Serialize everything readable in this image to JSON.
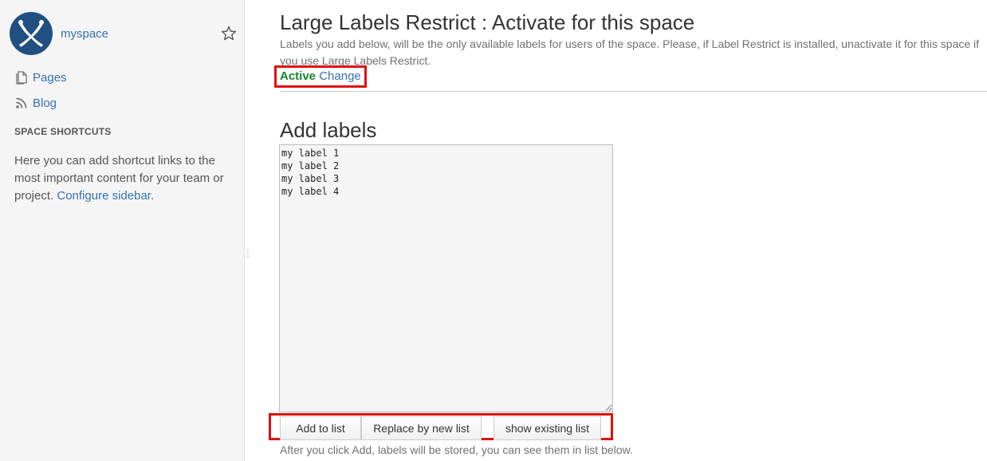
{
  "sidebar": {
    "space_name": "myspace",
    "nav": [
      {
        "label": "Pages",
        "icon": "pages-icon"
      },
      {
        "label": "Blog",
        "icon": "rss-icon"
      }
    ],
    "shortcuts": {
      "heading": "SPACE SHORTCUTS",
      "help_text": "Here you can add shortcut links to the most important content for your team or project.",
      "configure_link": "Configure sidebar",
      "trailing": "."
    }
  },
  "main": {
    "title": "Large Labels Restrict : Activate for this space",
    "description": "Labels you add below, will be the only available labels for users of the space. Please, if Label Restrict is installed, unactivate it for this space if you use Large Labels Restrict.",
    "status": {
      "state": "Active",
      "change_link": "Change"
    },
    "add_labels": {
      "heading": "Add labels",
      "textarea_value": "my label 1\nmy label 2\nmy label 3\nmy label 4",
      "buttons": {
        "add": "Add to list",
        "replace": "Replace by new list",
        "show": "show existing list"
      },
      "note": "After you click Add, labels will be stored, you can see them in list below."
    }
  },
  "colors": {
    "link": "#3572b0",
    "active": "#14892c",
    "highlight_box": "#e01010",
    "logo_bg": "#205081"
  }
}
